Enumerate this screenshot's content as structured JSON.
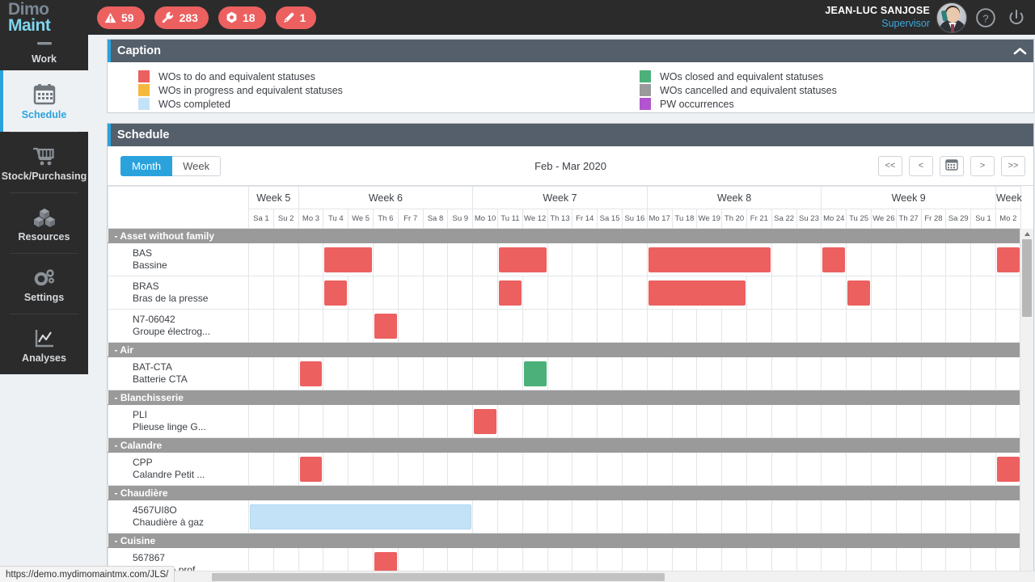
{
  "app": {
    "logo_line1": "Dimo",
    "logo_line2": "Maint",
    "status_url": "https://demo.mydimomaintmx.com/JLS/"
  },
  "topbar": {
    "kpis": [
      {
        "icon": "warning-triangle-icon",
        "value": "59"
      },
      {
        "icon": "wrench-icon",
        "value": "283"
      },
      {
        "icon": "nut-icon",
        "value": "18"
      },
      {
        "icon": "pen-icon",
        "value": "1"
      }
    ],
    "user_name": "JEAN-LUC SANJOSE",
    "user_role": "Supervisor",
    "help_icon": "question-circle-icon",
    "logout_icon": "power-icon"
  },
  "sidebar": {
    "items": [
      {
        "label": "Work",
        "icon": "work-icon",
        "active": false
      },
      {
        "label": "Schedule",
        "icon": "calendar-icon",
        "active": true
      },
      {
        "label": "Stock/Purchasing",
        "icon": "cart-icon",
        "active": false
      },
      {
        "label": "Resources",
        "icon": "boxes-icon",
        "active": false
      },
      {
        "label": "Settings",
        "icon": "gears-icon",
        "active": false
      },
      {
        "label": "Analyses",
        "icon": "chart-icon",
        "active": false
      }
    ]
  },
  "caption": {
    "title": "Caption",
    "collapse_icon": "chevron-up-icon",
    "left_items": [
      {
        "label": "WOs to do and equivalent statuses",
        "color": "#ec6060"
      },
      {
        "label": "WOs in progress and equivalent statuses",
        "color": "#f6b940"
      },
      {
        "label": "WOs completed",
        "color": "#c3e2f7"
      }
    ],
    "right_items": [
      {
        "label": "WOs closed and equivalent statuses",
        "color": "#4cb07a"
      },
      {
        "label": "WOs cancelled and equivalent statuses",
        "color": "#9a9a9a"
      },
      {
        "label": "PW occurrences",
        "color": "#b254cf"
      }
    ]
  },
  "schedule": {
    "title": "Schedule",
    "view_month": "Month",
    "view_week": "Week",
    "active_view": "Month",
    "period": "Feb - Mar 2020",
    "nav_buttons": [
      {
        "label": "<<",
        "name": "first-page-button"
      },
      {
        "label": "<",
        "name": "prev-page-button"
      },
      {
        "label": "",
        "name": "today-calendar-button"
      },
      {
        "label": ">",
        "name": "next-page-button"
      },
      {
        "label": ">>",
        "name": "last-page-button"
      }
    ],
    "weeks": [
      {
        "label": "Week 5",
        "days": 2
      },
      {
        "label": "Week 6",
        "days": 7
      },
      {
        "label": "Week 7",
        "days": 7
      },
      {
        "label": "Week 8",
        "days": 7
      },
      {
        "label": "Week 9",
        "days": 7
      },
      {
        "label": "Week",
        "days": 1
      }
    ],
    "days": [
      "Sa 1",
      "Su 2",
      "Mo 3",
      "Tu 4",
      "We 5",
      "Th 6",
      "Fr 7",
      "Sa 8",
      "Su 9",
      "Mo 10",
      "Tu 11",
      "We 12",
      "Th 13",
      "Fr 14",
      "Sa 15",
      "Su 16",
      "Mo 17",
      "Tu 18",
      "We 19",
      "Th 20",
      "Fr 21",
      "Sa 22",
      "Su 23",
      "Mo 24",
      "Tu 25",
      "We 26",
      "Th 27",
      "Fr 28",
      "Sa 29",
      "Su 1",
      "Mo 2"
    ],
    "rows": [
      {
        "type": "group",
        "label": "- Asset without family"
      },
      {
        "type": "asset",
        "code": "BAS",
        "name": "Bassine",
        "bars": [
          {
            "start": 3,
            "span": 2,
            "status": "todo"
          },
          {
            "start": 10,
            "span": 2,
            "status": "todo"
          },
          {
            "start": 16,
            "span": 5,
            "status": "todo"
          },
          {
            "start": 23,
            "span": 1,
            "status": "todo"
          },
          {
            "start": 30,
            "span": 1,
            "status": "todo"
          }
        ]
      },
      {
        "type": "asset",
        "code": "BRAS",
        "name": "Bras de la presse",
        "bars": [
          {
            "start": 3,
            "span": 1,
            "status": "todo"
          },
          {
            "start": 10,
            "span": 1,
            "status": "todo"
          },
          {
            "start": 16,
            "span": 4,
            "status": "todo"
          },
          {
            "start": 24,
            "span": 1,
            "status": "todo"
          }
        ]
      },
      {
        "type": "asset",
        "code": "N7-06042",
        "name": "Groupe électrog...",
        "bars": [
          {
            "start": 5,
            "span": 1,
            "status": "todo"
          }
        ]
      },
      {
        "type": "group",
        "label": "- Air"
      },
      {
        "type": "asset",
        "code": "BAT-CTA",
        "name": "Batterie CTA",
        "bars": [
          {
            "start": 2,
            "span": 1,
            "status": "todo"
          },
          {
            "start": 11,
            "span": 1,
            "status": "closed"
          }
        ]
      },
      {
        "type": "group",
        "label": "- Blanchisserie"
      },
      {
        "type": "asset",
        "code": "PLI",
        "name": "Plieuse linge G...",
        "bars": [
          {
            "start": 9,
            "span": 1,
            "status": "todo"
          }
        ]
      },
      {
        "type": "group",
        "label": "- Calandre"
      },
      {
        "type": "asset",
        "code": "CPP",
        "name": "Calandre Petit ...",
        "bars": [
          {
            "start": 2,
            "span": 1,
            "status": "todo"
          },
          {
            "start": 30,
            "span": 1,
            "status": "todo"
          }
        ]
      },
      {
        "type": "group",
        "label": "- Chaudière"
      },
      {
        "type": "asset",
        "code": "4567UI8O",
        "name": "Chaudière à gaz",
        "bars": [
          {
            "start": 0,
            "span": 9,
            "status": "done"
          }
        ]
      },
      {
        "type": "group",
        "label": "- Cuisine"
      },
      {
        "type": "asset",
        "code": "567867",
        "name": "Cuisinière prof...",
        "bars": [
          {
            "start": 5,
            "span": 1,
            "status": "todo"
          }
        ]
      }
    ]
  }
}
